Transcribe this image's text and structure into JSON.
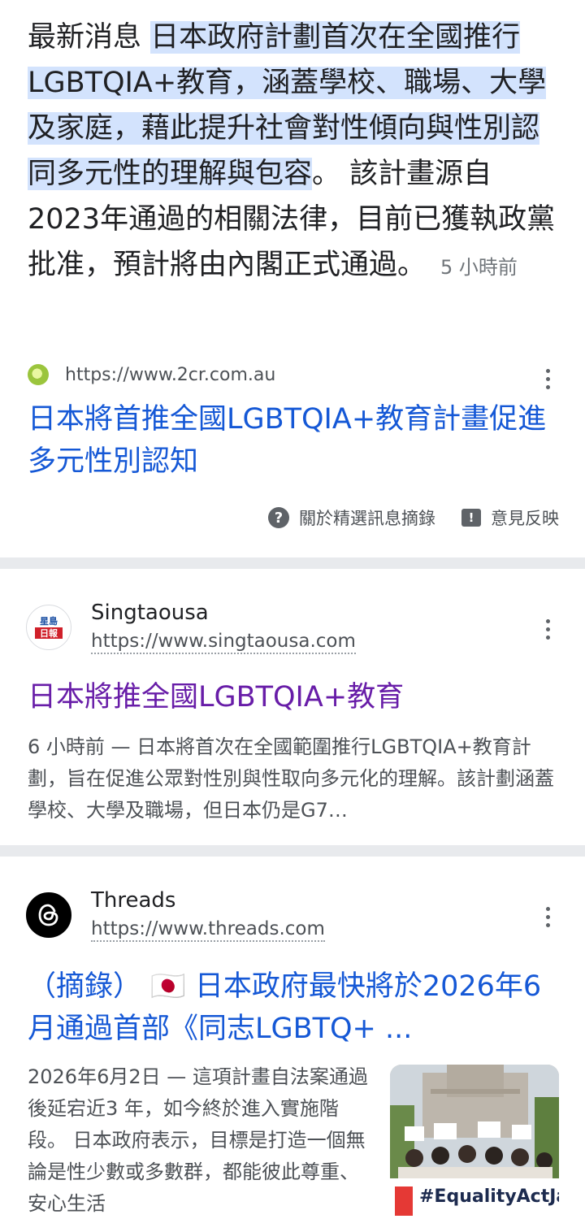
{
  "featured": {
    "prefix": "最新消息 ",
    "highlight": "日本政府計劃首次在全國推行LGBTQIA+教育，涵蓋學校、職場、大學及家庭，藉此提升社會對性傾向與性別認同多元性的理解與包容",
    "rest": "。 該計畫源自2023年通過的相關法律，目前已獲執政黨批准，預計將由內閣正式通過。",
    "time": "5 小時前",
    "source_url": "https://www.2cr.com.au",
    "link_title": "日本將首推全國LGBTQIA+教育計畫促進多元性別認知",
    "about_label": "關於精選訊息摘錄",
    "feedback_label": "意見反映"
  },
  "results": [
    {
      "site_name": "Singtaousa",
      "url": "https://www.singtaousa.com",
      "logo_text": "星島日報",
      "title": "日本將推全國LGBTQIA+教育",
      "description": "6 小時前 — 日本將首次在全國範圍推行LGBTQIA+教育計劃，旨在促進公眾對性別與性取向多元化的理解。該計劃涵蓋學校、大學及職場，但日本仍是G7…"
    },
    {
      "site_name": "Threads",
      "url": "https://www.threads.com",
      "logo_text": "@",
      "title": "（摘錄） 🇯🇵 日本政府最快將於2026年6月通過首部《同志LGBTQ+ ...",
      "description": "2026年6月2日 — 這項計畫自法案通過後延宕近3 年，如今終於進入實施階段。 日本政府表示，目標是打造一個無論是性少數或多數群，都能彼此尊重、安心生活",
      "thumb_banner": "#EqualityActJapa"
    }
  ],
  "colors": {
    "link": "#1558d6",
    "visited": "#681da8",
    "highlight": "#d3e3fd",
    "divider": "#e8eaed"
  }
}
